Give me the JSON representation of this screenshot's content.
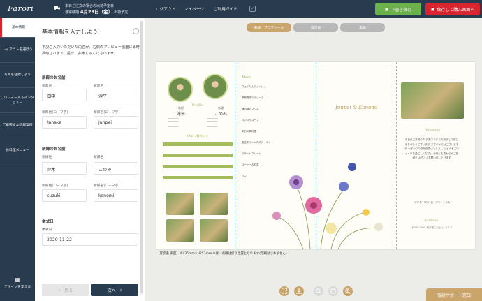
{
  "header": {
    "logo": "Farori",
    "notice_line1": "本日ご注文の場合の出荷予定日",
    "notice_prefix": "通常納期",
    "notice_date": "4月28日（金）",
    "notice_suffix": "出荷予定",
    "nav": [
      "ログアウト",
      "マイページ",
      "ご利用ガイド"
    ],
    "save_draft": "下書き保存",
    "save_buy": "保存して購入画面へ"
  },
  "sidenav": {
    "items": [
      "基本情報",
      "レイアウトを選ぼう",
      "写真を登録しよう",
      "プロフィール＆インタビュー",
      "ご挨拶文＆新居案内",
      "お料理メニュー"
    ],
    "design": "デザインを変える"
  },
  "form": {
    "title": "基本情報を入力しよう",
    "help": "?",
    "description": "下記ご入力いただいた内容が、右側のプレビュー画面に即時反映されます。是非、お楽しみくださいませ。",
    "groom_section": "新郎のお名前",
    "bride_section": "新婦のお名前",
    "date_section": "挙式日",
    "fields": {
      "groom_last_label": "新郎姓",
      "groom_last": "田中",
      "groom_first_label": "新郎名",
      "groom_first": "淳平",
      "groom_last_roman_label": "新郎姓(ローマ字)",
      "groom_last_roman": "tanaka",
      "groom_first_roman_label": "新郎名(ローマ字)",
      "groom_first_roman": "junpei",
      "bride_last_label": "新婦姓",
      "bride_last": "鈴木",
      "bride_first_label": "新婦名",
      "bride_first": "このみ",
      "bride_last_roman_label": "新婦姓(ローマ字)",
      "bride_last_roman": "suzuki",
      "bride_first_roman_label": "新婦名(ローマ字)",
      "bride_first_roman": "konomi",
      "date_label": "挙式日",
      "date": "2020-11-22"
    },
    "back": "戻る",
    "next": "次へ"
  },
  "preview": {
    "tabs": [
      "表紙、プロフィール",
      "席次表",
      "裏紙"
    ],
    "caption": "【席次表 表面】W435mm×H257mm ※青い点線は折り位置となります(印刷はされません)",
    "groom_role": "新郎",
    "groom_name": "淳平",
    "bride_role": "新婦",
    "bride_name": "このみ",
    "profile_script": "Profile",
    "history_script": "Our History",
    "menu_title": "Menu",
    "menu_items": [
      "ウェルカムディッシュ",
      "季節野菜のテリーヌ",
      "海の幸のマリネ",
      "コンソメスープ",
      "本日の魚料理",
      "国産牛フィレ肉のロースト",
      "デザートプレート",
      "コーヒー＆紅茶",
      "パン"
    ],
    "couple_title": "Junpei & Konomi",
    "message_title": "Message",
    "message": "本日はご多用の中 お集まりいただきまして誠にありがとうございます ささやかではございますが 心ばかりの宴を用意いたしました どうぞごゆっくりお過ごしください 今後とも変わらぬご指導を よろしくお願い申し上げます",
    "message_date": "2020年11月22日　淳平・このみ",
    "address_title": "Address",
    "address": "〒000-0000 東京都○○区○○ 0-0-0"
  },
  "footer": {
    "support": "電話サポート窓口"
  },
  "colors": {
    "navy": "#283b4f",
    "green": "#6bb24a",
    "red": "#d9252e",
    "gold": "#c9a46b"
  }
}
